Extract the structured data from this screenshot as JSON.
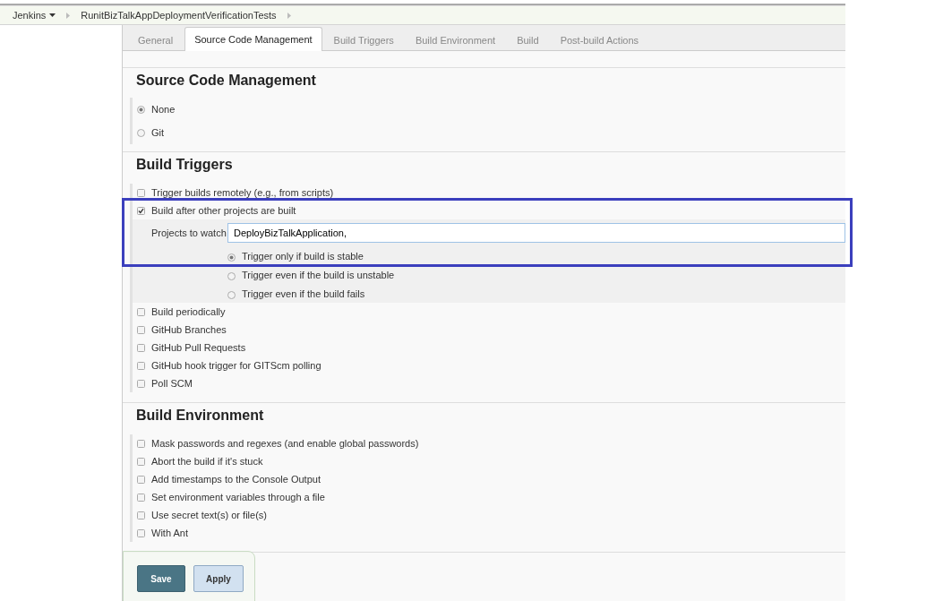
{
  "breadcrumbs": [
    {
      "label": "Jenkins",
      "dropdown": true
    },
    {
      "label": "RunitBizTalkAppDeploymentVerificationTests",
      "dropdown": false
    }
  ],
  "tabs": [
    {
      "label": "General",
      "selected": false
    },
    {
      "label": "Source Code Management",
      "selected": true
    },
    {
      "label": "Build Triggers",
      "selected": false
    },
    {
      "label": "Build Environment",
      "selected": false
    },
    {
      "label": "Build",
      "selected": false
    },
    {
      "label": "Post-build Actions",
      "selected": false
    }
  ],
  "sections": [
    {
      "title": "Source Code Management",
      "options": [
        {
          "kind": "radio",
          "label": "None",
          "selected": true
        },
        {
          "kind": "radio",
          "label": "Git",
          "selected": false
        }
      ]
    },
    {
      "title": "Build Triggers",
      "options": [
        {
          "kind": "checkbox",
          "label": "Trigger builds remotely (e.g., from scripts)",
          "checked": false
        },
        {
          "kind": "checkbox",
          "label": "Build after other projects are built",
          "checked": true,
          "details": {
            "field_label": "Projects to watch",
            "value": "DeployBizTalkApplication, ",
            "radios": [
              {
                "label": "Trigger only if build is stable",
                "selected": true
              },
              {
                "label": "Trigger even if the build is unstable",
                "selected": false
              },
              {
                "label": "Trigger even if the build fails",
                "selected": false
              }
            ]
          }
        },
        {
          "kind": "checkbox",
          "label": "Build periodically",
          "checked": false
        },
        {
          "kind": "checkbox",
          "label": "GitHub Branches",
          "checked": false
        },
        {
          "kind": "checkbox",
          "label": "GitHub Pull Requests",
          "checked": false
        },
        {
          "kind": "checkbox",
          "label": "GitHub hook trigger for GITScm polling",
          "checked": false
        },
        {
          "kind": "checkbox",
          "label": "Poll SCM",
          "checked": false
        }
      ]
    },
    {
      "title": "Build Environment",
      "options": [
        {
          "kind": "checkbox",
          "label": "Mask passwords and regexes (and enable global passwords)",
          "checked": false
        },
        {
          "kind": "checkbox",
          "label": "Abort the build if it's stuck",
          "checked": false
        },
        {
          "kind": "checkbox",
          "label": "Add timestamps to the Console Output",
          "checked": false
        },
        {
          "kind": "checkbox",
          "label": "Set environment variables through a file",
          "checked": false
        },
        {
          "kind": "checkbox",
          "label": "Use secret text(s) or file(s)",
          "checked": false
        },
        {
          "kind": "checkbox",
          "label": "With Ant",
          "checked": false
        }
      ]
    }
  ],
  "actions": {
    "save": "Save",
    "apply": "Apply"
  }
}
